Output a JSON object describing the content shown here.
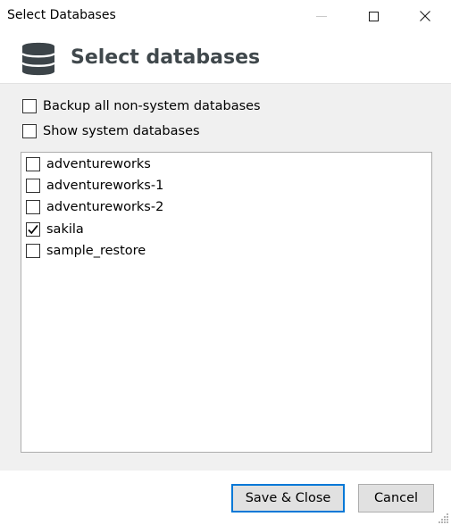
{
  "window": {
    "title": "Select Databases",
    "controls": {
      "minimize": "minimize-icon",
      "maximize": "maximize-icon",
      "close": "close-icon"
    }
  },
  "header": {
    "icon": "database-icon",
    "title": "Select databases",
    "icon_color": "#3c4449"
  },
  "options": {
    "backup_all": {
      "label": "Backup all non-system databases",
      "checked": false
    },
    "show_system": {
      "label": "Show system databases",
      "checked": false
    }
  },
  "databases": [
    {
      "name": "adventureworks",
      "checked": false
    },
    {
      "name": "adventureworks-1",
      "checked": false
    },
    {
      "name": "adventureworks-2",
      "checked": false
    },
    {
      "name": "sakila",
      "checked": true
    },
    {
      "name": "sample_restore",
      "checked": false
    }
  ],
  "footer": {
    "save_label": "Save & Close",
    "cancel_label": "Cancel"
  },
  "colors": {
    "accent": "#0078d7",
    "content_bg": "#f0f0f0",
    "button_bg": "#e1e1e1"
  }
}
